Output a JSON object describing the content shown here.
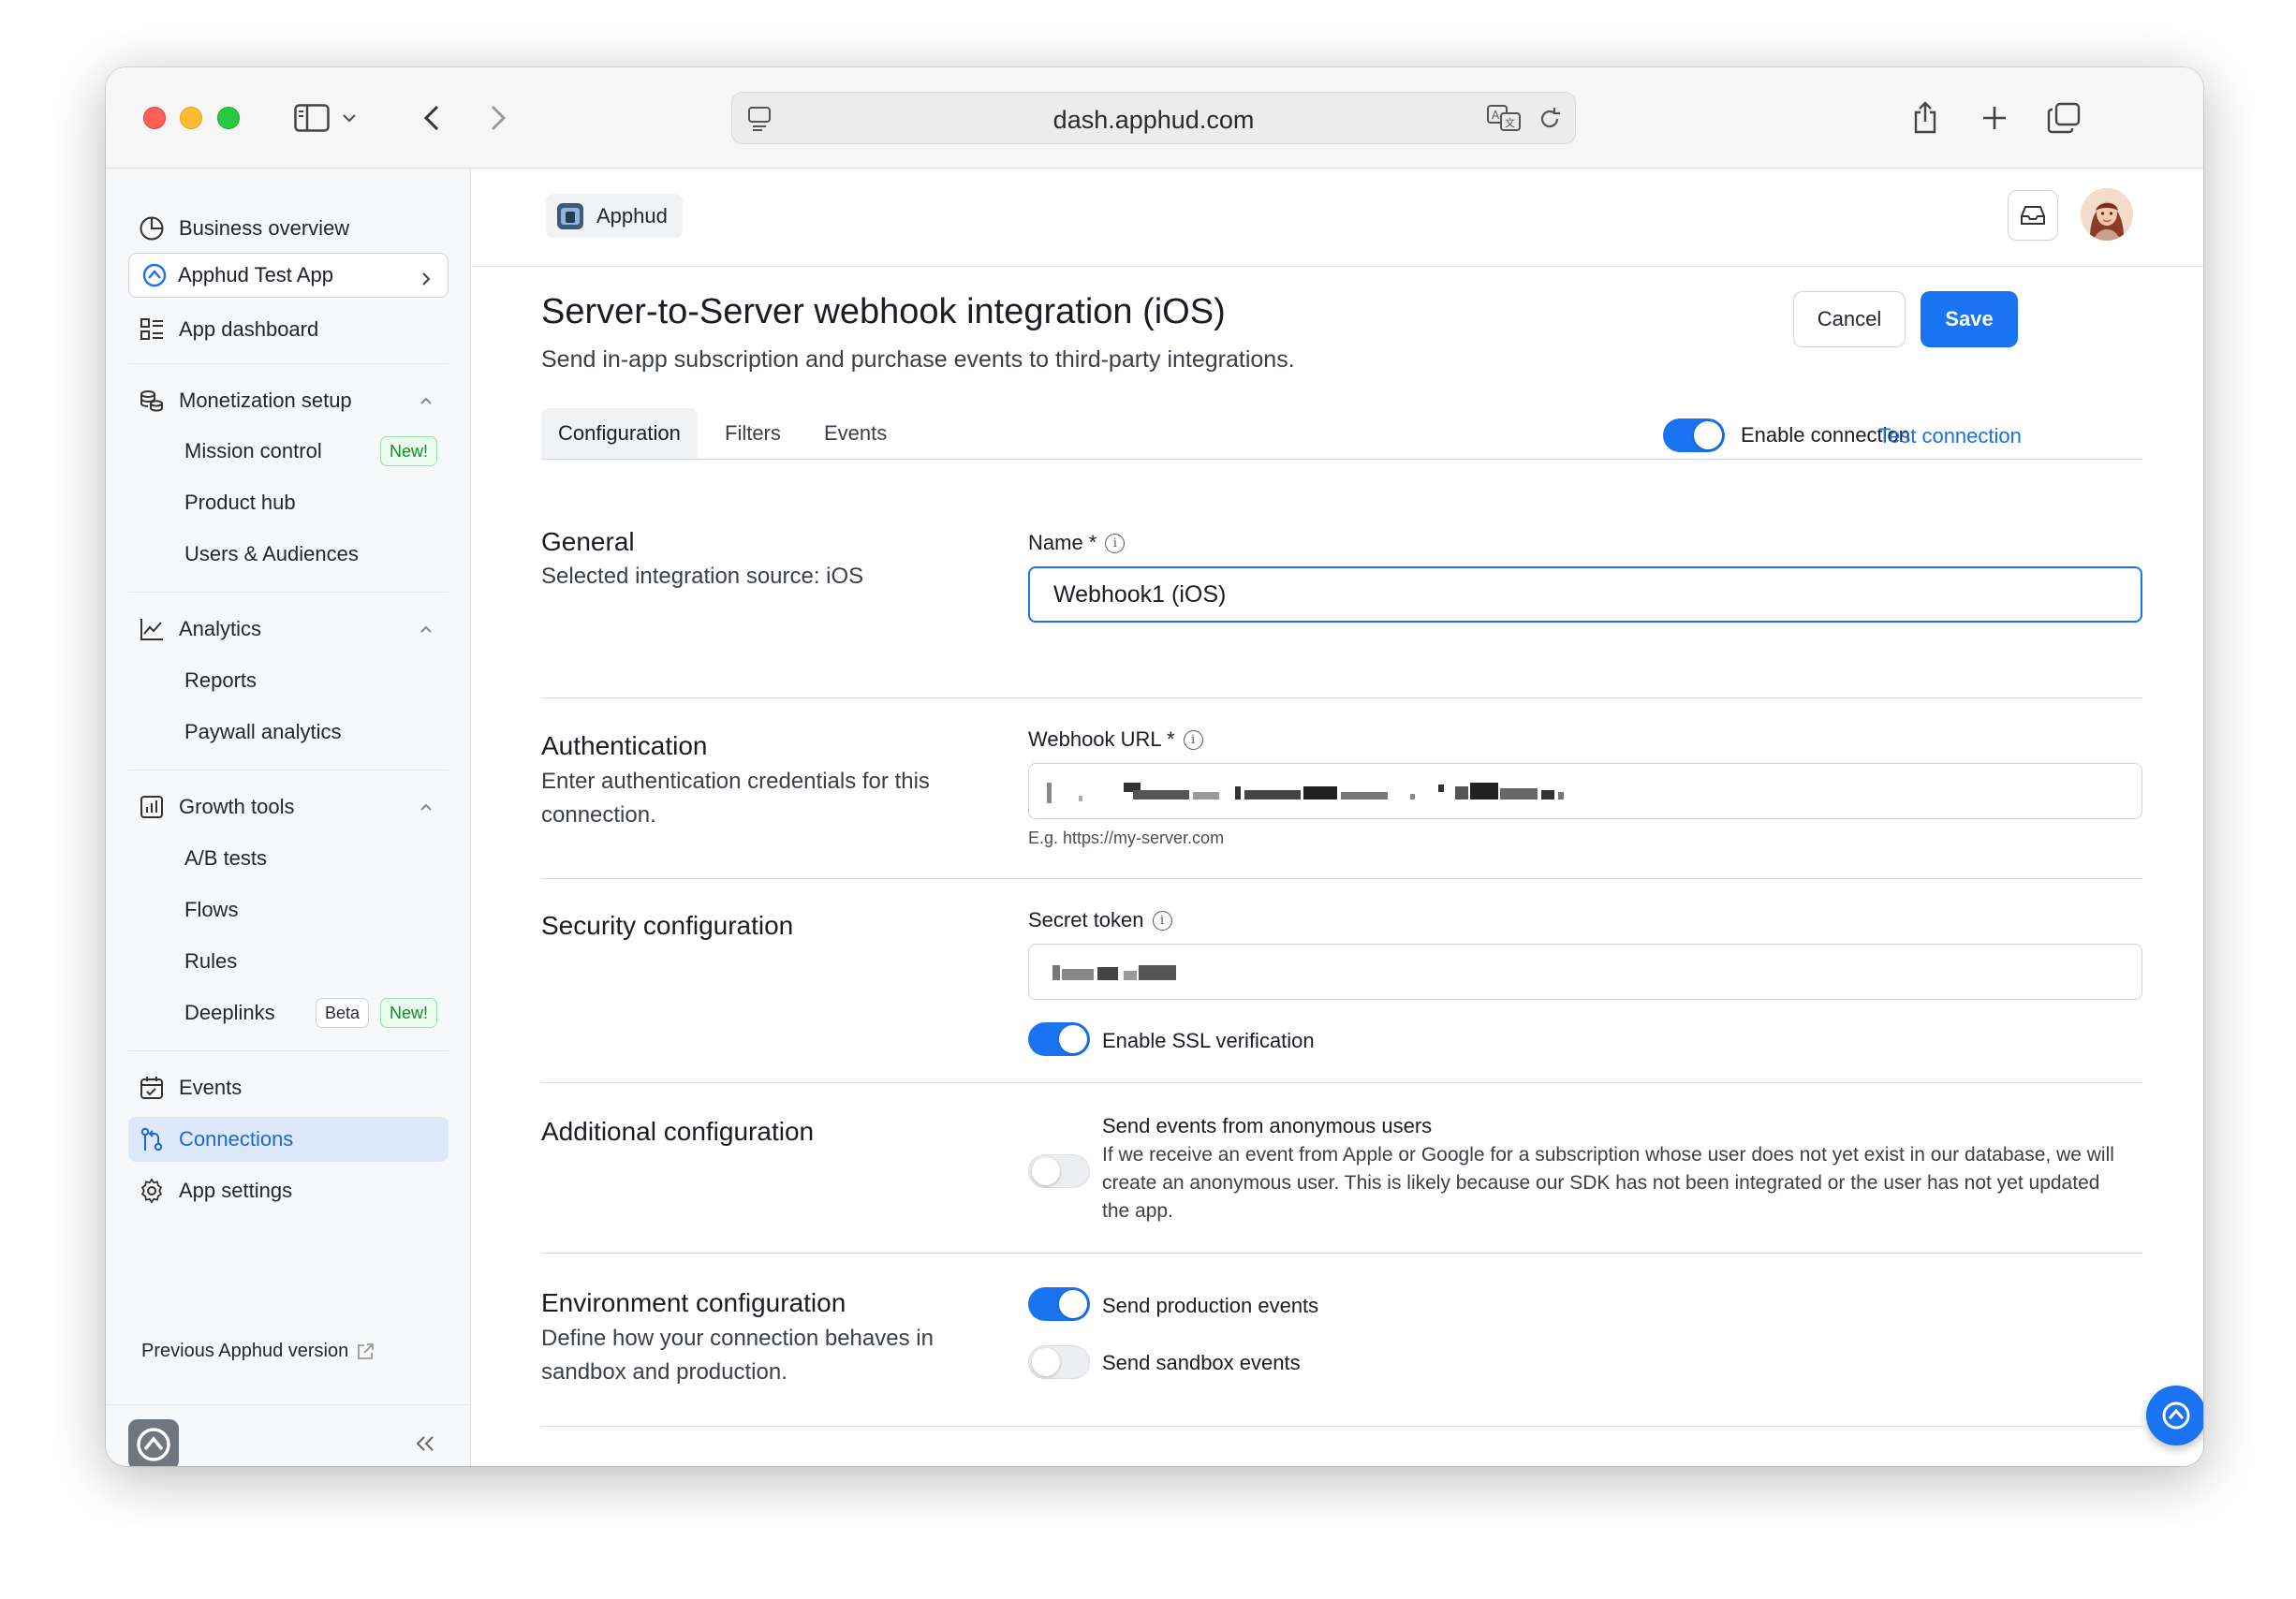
{
  "browser": {
    "url": "dash.apphud.com"
  },
  "sidebar": {
    "business_overview": "Business overview",
    "app_selector": "Apphud Test App",
    "app_dashboard": "App dashboard",
    "monetization": {
      "label": "Monetization setup",
      "items": [
        {
          "label": "Mission control",
          "badge": "New!"
        },
        {
          "label": "Product hub"
        },
        {
          "label": "Users & Audiences"
        }
      ]
    },
    "analytics": {
      "label": "Analytics",
      "items": [
        {
          "label": "Reports"
        },
        {
          "label": "Paywall analytics"
        }
      ]
    },
    "growth": {
      "label": "Growth tools",
      "items": [
        {
          "label": "A/B tests"
        },
        {
          "label": "Flows"
        },
        {
          "label": "Rules"
        },
        {
          "label": "Deeplinks",
          "badge_beta": "Beta",
          "badge_new": "New!"
        }
      ]
    },
    "events": "Events",
    "connections": "Connections",
    "app_settings": "App settings",
    "previous_version": "Previous Apphud version"
  },
  "header": {
    "app_chip": "Apphud"
  },
  "page": {
    "title": "Server-to-Server webhook integration (iOS)",
    "subtitle": "Send in-app subscription and purchase events to third-party integrations.",
    "cancel": "Cancel",
    "save": "Save"
  },
  "tabs": [
    {
      "label": "Configuration",
      "active": true
    },
    {
      "label": "Filters",
      "active": false
    },
    {
      "label": "Events",
      "active": false
    }
  ],
  "connection": {
    "enable_label": "Enable connection",
    "enabled": true,
    "test_label": "Test connection"
  },
  "sections": {
    "general": {
      "title": "General",
      "desc": "Selected integration source: iOS",
      "name_label": "Name *",
      "name_value": "Webhook1 (iOS)"
    },
    "auth": {
      "title": "Authentication",
      "desc": "Enter authentication credentials for this connection.",
      "url_label": "Webhook URL *",
      "url_hint": "E.g. https://my-server.com"
    },
    "security": {
      "title": "Security configuration",
      "token_label": "Secret token",
      "ssl_label": "Enable SSL verification",
      "ssl_enabled": true
    },
    "additional": {
      "title": "Additional configuration",
      "anon_label": "Send events from anonymous users",
      "anon_desc": "If we receive an event from Apple or Google for a subscription whose user does not yet exist in our database, we will create an anonymous user. This is likely because our SDK has not been integrated or the user has not yet updated the app.",
      "anon_enabled": false
    },
    "environment": {
      "title": "Environment configuration",
      "desc": "Define how your connection behaves in sandbox and production.",
      "prod_label": "Send production events",
      "prod_enabled": true,
      "sandbox_label": "Send sandbox events",
      "sandbox_enabled": false
    }
  },
  "colors": {
    "accent": "#1a73f0",
    "active_nav_bg": "#dde9fb",
    "new_badge": "#19882f"
  }
}
